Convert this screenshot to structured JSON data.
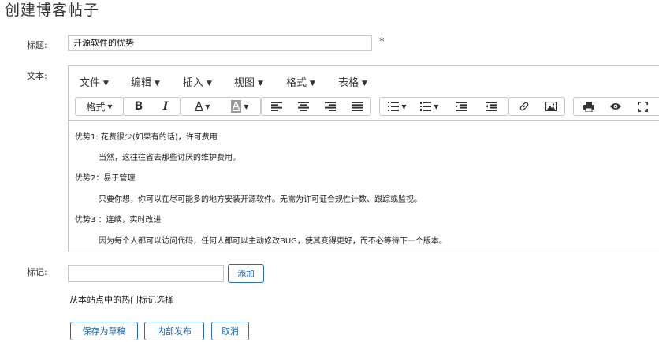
{
  "page": {
    "title": "创建博客帖子"
  },
  "form": {
    "title_label": "标题:",
    "title_value": "开源软件的优势",
    "required_mark": "*",
    "body_label": "文本:",
    "tags_label": "标记:",
    "tags_value": "",
    "add_tag_button": "添加",
    "popular_tags_link": "从本站点中的热门标记选择"
  },
  "editor": {
    "menu": [
      {
        "label": "文件",
        "caret": "▼"
      },
      {
        "label": "编辑",
        "caret": "▼"
      },
      {
        "label": "插入",
        "caret": "▼"
      },
      {
        "label": "视图",
        "caret": "▼"
      },
      {
        "label": "格式",
        "caret": "▼"
      },
      {
        "label": "表格",
        "caret": "▼"
      }
    ],
    "toolbar": {
      "format_label": "格式",
      "caret": "▼",
      "bold": "B",
      "italic": "I",
      "text_color": "A",
      "bg_color": "A",
      "icons": [
        "align-left-icon",
        "align-center-icon",
        "align-right-icon",
        "align-justify-icon",
        "bullet-list-icon",
        "numbered-list-icon",
        "outdent-icon",
        "indent-icon",
        "link-icon",
        "image-icon",
        "print-icon",
        "preview-icon",
        "fullscreen-icon"
      ]
    },
    "content": [
      {
        "text": "优势1: 花费很少(如果有的话)，许可费用",
        "indent": false
      },
      {
        "text": "当然，这往往省去那些讨厌的维护费用。",
        "indent": true
      },
      {
        "text": "优势2：易于管理",
        "indent": false
      },
      {
        "text": "只要你想，你可以在尽可能多的地方安装开源软件。无需为许可证合规性计数、跟踪或监视。",
        "indent": true
      },
      {
        "text": "优势3 ：连续，实时改进",
        "indent": false
      },
      {
        "text": "因为每个人都可以访问代码，任何人都可以主动修改BUG，使其变得更好，而不必等待下一个版本。",
        "indent": true
      }
    ]
  },
  "actions": {
    "save_draft": "保存为草稿",
    "publish_internal": "内部发布",
    "cancel": "取消"
  },
  "colors": {
    "accent": "#1b63b0",
    "border": "#c9c9c9"
  }
}
